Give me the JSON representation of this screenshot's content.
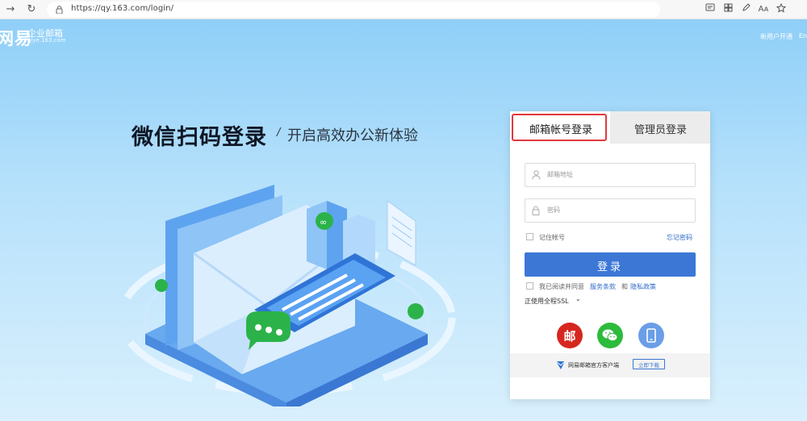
{
  "browser": {
    "back_icon": "arrow-left-icon",
    "refresh_icon": "refresh-icon",
    "url": "https://qy.163.com/login/",
    "toolbar_icons": [
      "reader-view-icon",
      "apps-icon",
      "pen-icon",
      "read-aloud-icon",
      "favorite-icon"
    ],
    "reader_text": "Aᴀ"
  },
  "header": {
    "logo_glyph": "网易",
    "logo_main": "企业邮箱",
    "logo_sub": "qiye.163.com",
    "new_user_link": "新用户开通",
    "lang_link": "En"
  },
  "hero": {
    "title": "微信扫码登录",
    "separator": "/",
    "subtitle": "开启高效办公新体验"
  },
  "login": {
    "tabs": [
      {
        "label": "邮箱帐号登录",
        "active": true
      },
      {
        "label": "管理员登录",
        "active": false
      }
    ],
    "email_placeholder": "邮箱地址",
    "password_placeholder": "密码",
    "remember_label": "记住帐号",
    "forgot_label": "忘记密码",
    "submit_label": "登录",
    "agree_prefix": "我已阅读并同意",
    "terms_link": "服务条款",
    "and_text": "和",
    "privacy_link": "隐私政策",
    "ssl_text": "正使用全程SSL",
    "ssl_caret": "⌄",
    "alt_logins": [
      {
        "icon": "netease-mail-icon",
        "glyph": "邮",
        "color": "#d6261f"
      },
      {
        "icon": "wechat-icon",
        "color": "#2dbb3c"
      },
      {
        "icon": "mobile-icon",
        "color": "#6a9ee8"
      }
    ],
    "client_text": "网易邮箱官方客户端",
    "download_label": "立即下载"
  }
}
